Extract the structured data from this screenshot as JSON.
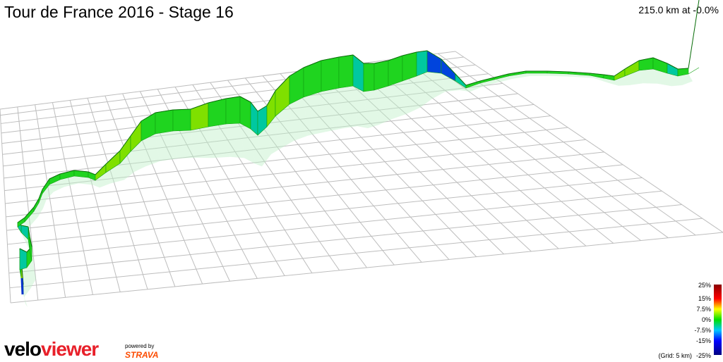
{
  "header": {
    "title": "Tour de France 2016 - Stage 16",
    "readout": "215.0 km at -0.0%"
  },
  "legend": {
    "labels": [
      "25%",
      "15%",
      "7.5%",
      "0%",
      "-7.5%",
      "-15%",
      "-25%"
    ],
    "grid_note": "(Grid: 5 km)"
  },
  "branding": {
    "logo_part1": "velo",
    "logo_part2": "viewer",
    "powered_by": "powered by",
    "partner": "STRAVA"
  },
  "colors": {
    "profile_green": "#22dd22",
    "brand_red": "#e8202a",
    "strava_orange": "#fc4c02"
  }
}
